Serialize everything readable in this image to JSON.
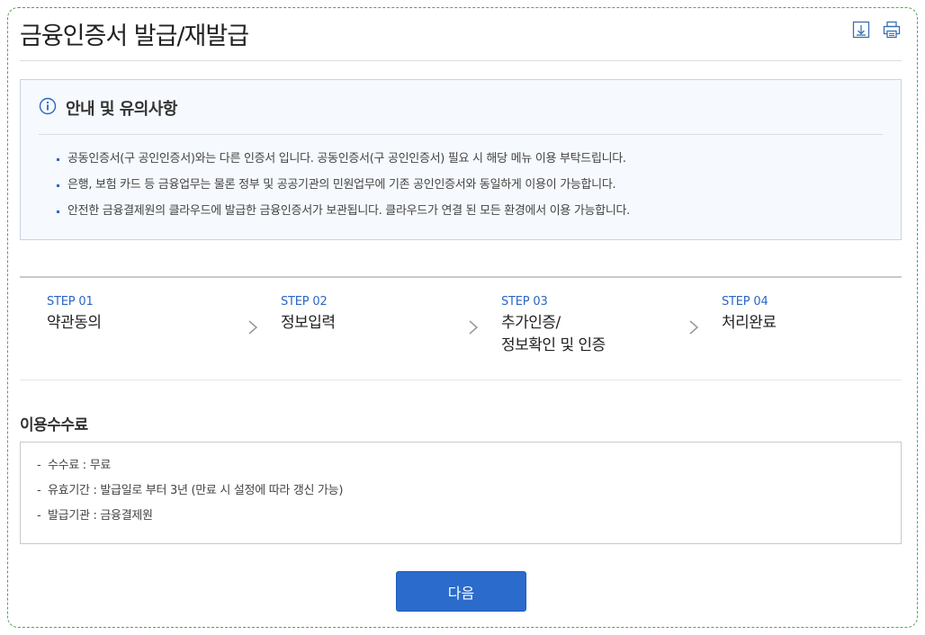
{
  "page": {
    "title": "금융인증서 발급/재발급"
  },
  "toolbar": {
    "icons": [
      "download-icon",
      "print-icon"
    ]
  },
  "notice": {
    "title": "안내 및 유의사항",
    "items": [
      "공동인증서(구 공인인증서)와는 다른 인증서 입니다. 공동인증서(구 공인인증서) 필요 시 해당 메뉴 이용 부탁드립니다.",
      "은행, 보험 카드 등 금융업무는 물론 정부 및 공공기관의 민원업무에 기존 공인인증서와 동일하게 이용이 가능합니다.",
      "안전한 금융결제원의 클라우드에 발급한 금융인증서가 보관됩니다. 클라우드가 연결 된 모든 환경에서 이용 가능합니다."
    ]
  },
  "steps": [
    {
      "no": "STEP 01",
      "label": "약관동의"
    },
    {
      "no": "STEP 02",
      "label": "정보입력"
    },
    {
      "no": "STEP 03",
      "label_line1": "추가인증/",
      "label_line2": "정보확인 및 인증"
    },
    {
      "no": "STEP 04",
      "label": "처리완료"
    }
  ],
  "fee": {
    "title": "이용수수료",
    "items": [
      "수수료 : 무료",
      "유효기간 : 발급일로 부터 3년 (만료 시 설정에 따라 갱신 가능)",
      "발급기관 : 금융결제원"
    ]
  },
  "buttons": {
    "next_label": "다음"
  },
  "colors": {
    "accent": "#2a6bcc",
    "step_blue": "#2b66c4",
    "notice_bg": "#f6f9fd",
    "frame_border": "#5aa05a"
  }
}
